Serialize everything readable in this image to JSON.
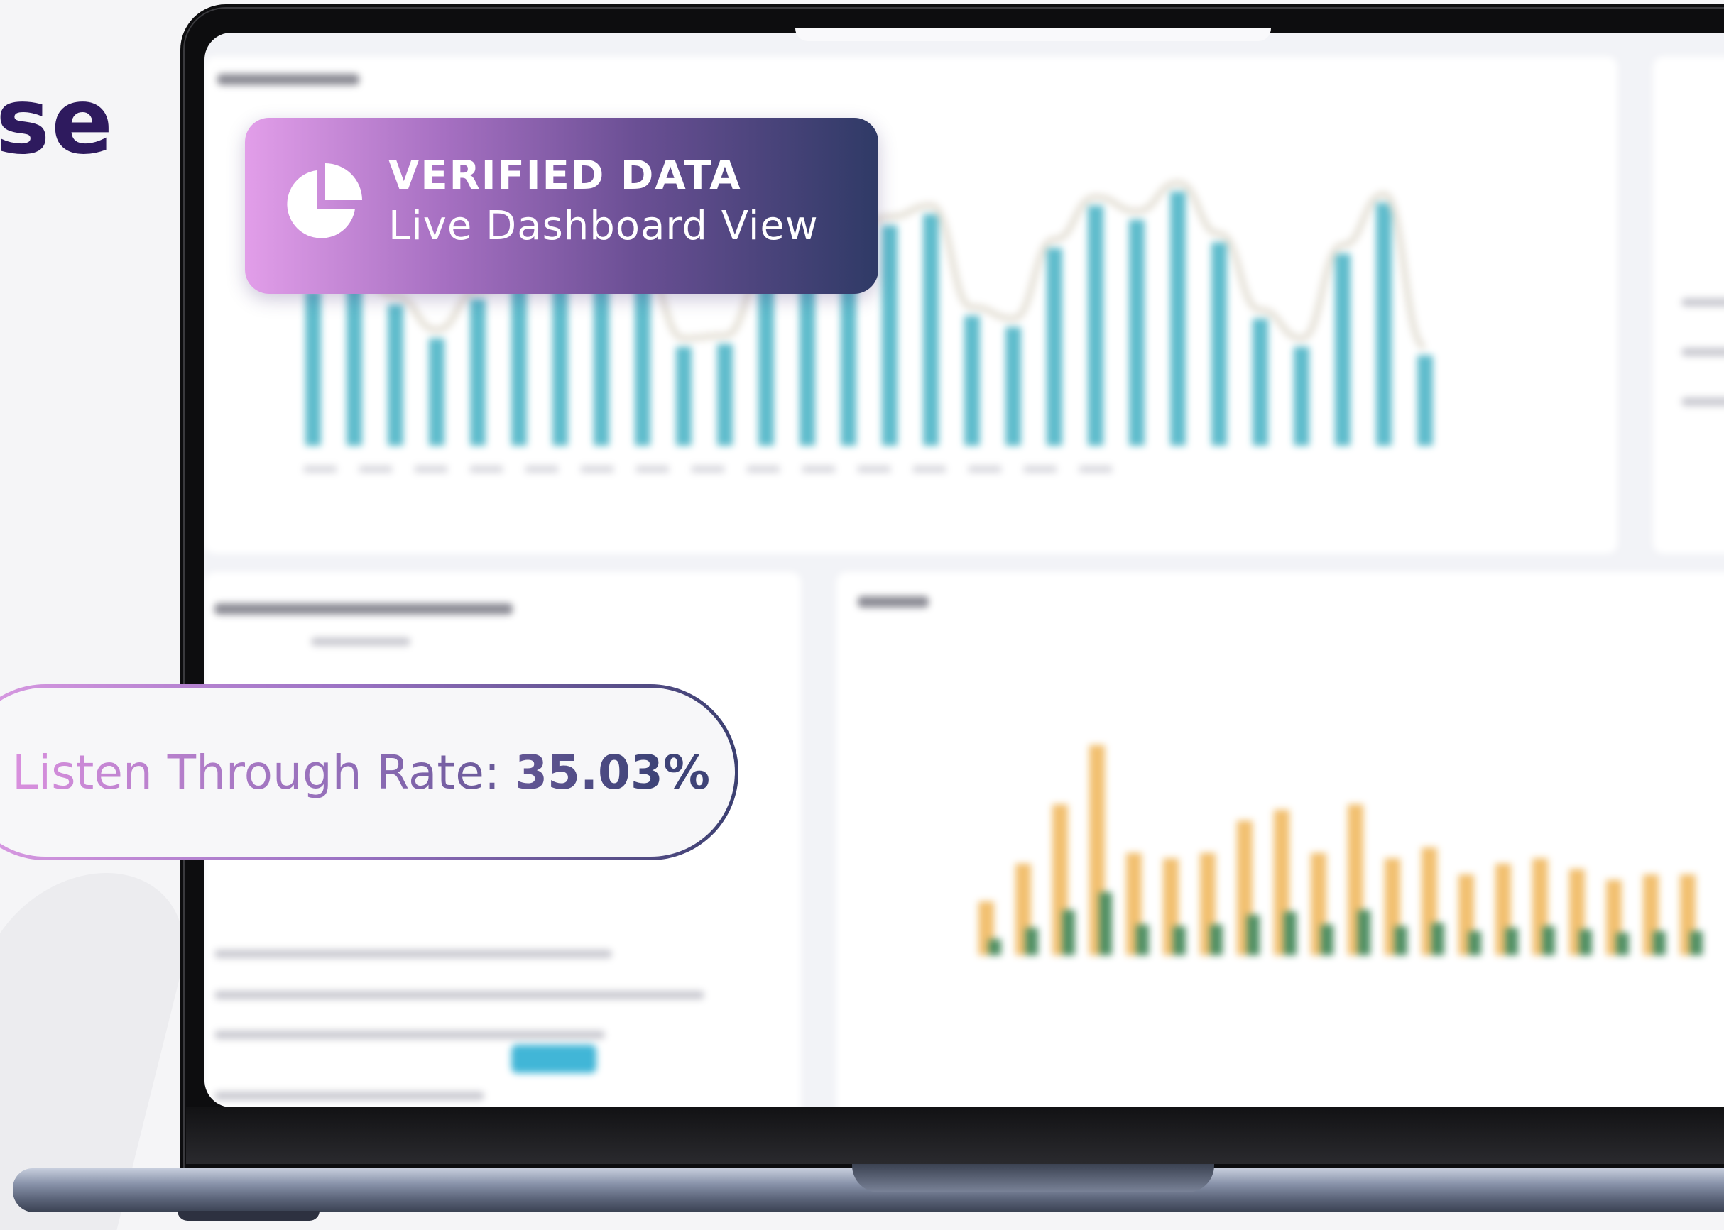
{
  "heading": {
    "fragment": "se"
  },
  "badge": {
    "icon": "pie-chart-icon",
    "title": "VERIFIED DATA",
    "subtitle": "Live Dashboard View"
  },
  "pill": {
    "label": "Listen Through Rate:",
    "value": "35.03%"
  },
  "colors": {
    "heading": "#2e1a5e",
    "teal_bars": "#5fbccc",
    "orange_bars": "#f2c070",
    "green_bars": "#4f8f63",
    "badge_gradient_start": "#e29ee9",
    "badge_gradient_end": "#2f3a66"
  }
}
